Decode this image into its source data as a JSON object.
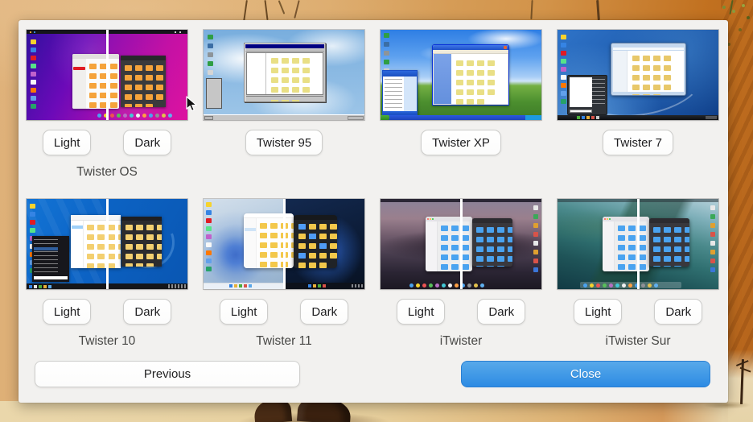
{
  "dialog": {
    "tiles": [
      {
        "name": "Twister OS",
        "light": "Light",
        "dark": "Dark"
      },
      {
        "button": "Twister 95"
      },
      {
        "button": "Twister XP"
      },
      {
        "button": "Twister 7"
      },
      {
        "name": "Twister 10",
        "light": "Light",
        "dark": "Dark"
      },
      {
        "name": "Twister 11",
        "light": "Light",
        "dark": "Dark"
      },
      {
        "name": "iTwister",
        "light": "Light",
        "dark": "Dark"
      },
      {
        "name": "iTwister Sur",
        "light": "Light",
        "dark": "Dark"
      }
    ],
    "footer": {
      "previous": "Previous",
      "close": "Close"
    },
    "colors": {
      "accent_blue": "#2d8be3",
      "dialog_bg": "#f2f1ef",
      "button_border": "#cdcdcb"
    }
  },
  "icons": {
    "cursor": "arrow-cursor"
  }
}
